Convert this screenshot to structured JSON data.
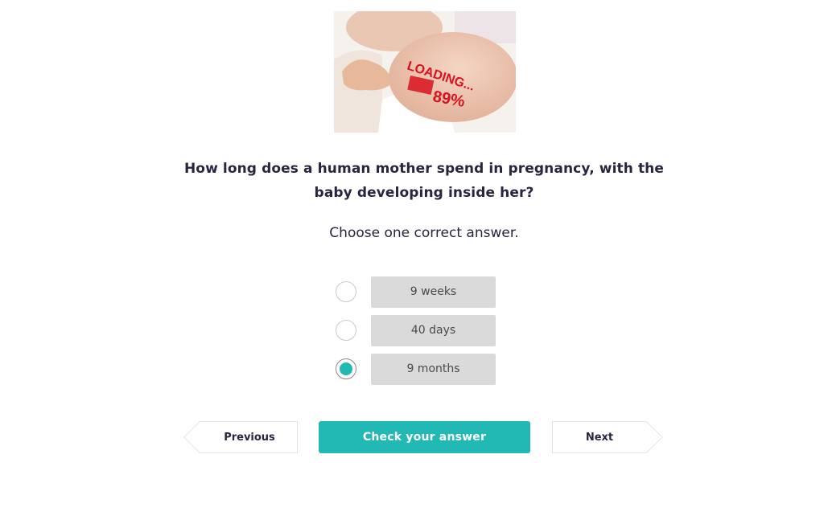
{
  "question": {
    "image_alt": "Pregnant belly painted with LOADING 89%",
    "image_text_line1": "LOADING...",
    "image_text_line2": "89%",
    "text": "How long does a human mother spend in pregnancy, with the baby developing inside her?",
    "instruction": "Choose one correct answer."
  },
  "options": [
    {
      "label": "9 weeks",
      "selected": false
    },
    {
      "label": "40 days",
      "selected": false
    },
    {
      "label": "9 months",
      "selected": true
    }
  ],
  "buttons": {
    "previous": "Previous",
    "check": "Check your answer",
    "next": "Next"
  },
  "colors": {
    "accent": "#22b9b4",
    "text": "#2a2440",
    "option_bg": "#dadada"
  }
}
